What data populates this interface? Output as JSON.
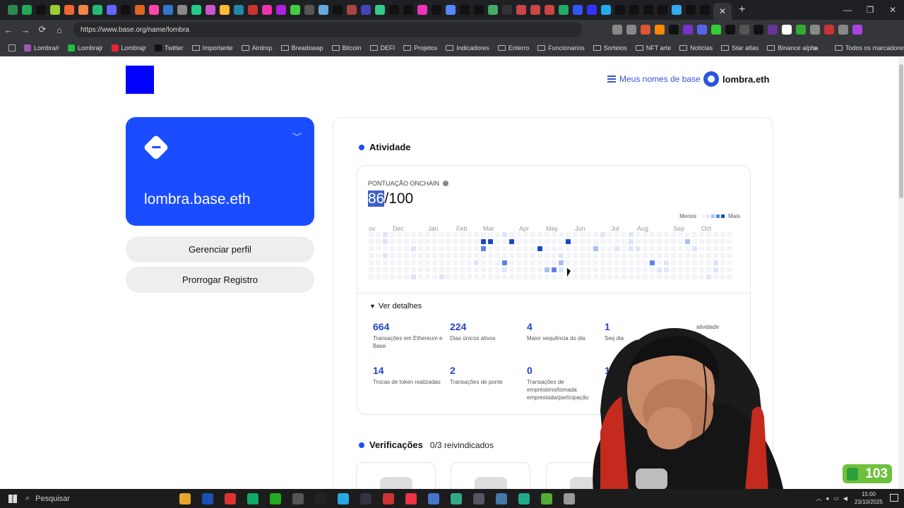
{
  "browser": {
    "url": "https://www.base.org/name/lombra",
    "tab_close": "✕",
    "new_tab": "+",
    "window_controls": [
      "—",
      "❐",
      "✕"
    ],
    "nav": [
      "←",
      "→",
      "⟳",
      "⌂"
    ],
    "bookmarks": [
      {
        "label": "Lombra/r",
        "type": "site",
        "color": "#9b59b6"
      },
      {
        "label": "Lombrajr",
        "type": "site",
        "color": "#22bb44"
      },
      {
        "label": "Lombrajr",
        "type": "site",
        "color": "#ee2233"
      },
      {
        "label": "Twitter",
        "type": "site",
        "color": "#111111"
      },
      {
        "label": "Importante",
        "type": "folder"
      },
      {
        "label": "Airdrop",
        "type": "folder"
      },
      {
        "label": "Breadswap",
        "type": "folder"
      },
      {
        "label": "Bitcoin",
        "type": "folder"
      },
      {
        "label": "DEFI",
        "type": "folder"
      },
      {
        "label": "Projetos",
        "type": "folder"
      },
      {
        "label": "Indicadores",
        "type": "folder"
      },
      {
        "label": "Enterro",
        "type": "folder"
      },
      {
        "label": "Funcionarios",
        "type": "folder"
      },
      {
        "label": "Sorteios",
        "type": "folder"
      },
      {
        "label": "NFT arte",
        "type": "folder"
      },
      {
        "label": "Noticias",
        "type": "folder"
      },
      {
        "label": "Star atlas",
        "type": "folder"
      },
      {
        "label": "Binance alpha",
        "type": "folder"
      }
    ],
    "bookmarks_more": "»",
    "all_bookmarks": "Todos os marcadores"
  },
  "header": {
    "my_names": "Meus nomes de base",
    "account": "lombra.eth"
  },
  "profile": {
    "name": "lombra.base.eth",
    "manage_button": "Gerenciar perfil",
    "extend_button": "Prorrogar Registro"
  },
  "activity": {
    "title": "Atividade",
    "score_label": "PONTUAÇÃO ONCHAIN",
    "score_value": "86",
    "score_max": "/100",
    "legend_less": "Menos",
    "legend_more": "Mais",
    "months": [
      "ov",
      "Dec",
      "Jan",
      "Feb",
      "Mar",
      "Apr",
      "May",
      "Jun",
      "Jul",
      "Aug",
      "Sep",
      "Oct"
    ],
    "heatmap_levels": [
      "#f3f4f8",
      "#dde5fb",
      "#a9bff3",
      "#5c82e8",
      "#1a47cc"
    ],
    "see_details": "Ver detalhes",
    "stats": [
      {
        "value": "664",
        "label": "Transações em Ethereum e Base"
      },
      {
        "value": "224",
        "label": "Dias únicos ativos"
      },
      {
        "value": "4",
        "label": "Maior sequência do dia"
      },
      {
        "value": "1",
        "label": "Seq dia"
      },
      {
        "value": "",
        "label": "atividade"
      },
      {
        "value": "14",
        "label": "Trocas de token realizadas"
      },
      {
        "value": "2",
        "label": "Transações de ponte"
      },
      {
        "value": "0",
        "label": "Transações de empréstimo/tomada emprestada/participação"
      },
      {
        "value": "1",
        "label": "Int"
      }
    ]
  },
  "verifications": {
    "title": "Verificações",
    "count": "0/3 reivindicados"
  },
  "overlay": {
    "badge_value": "103"
  },
  "taskbar": {
    "search": "Pesquisar",
    "time": "15:00",
    "date": "23/10/2025"
  }
}
